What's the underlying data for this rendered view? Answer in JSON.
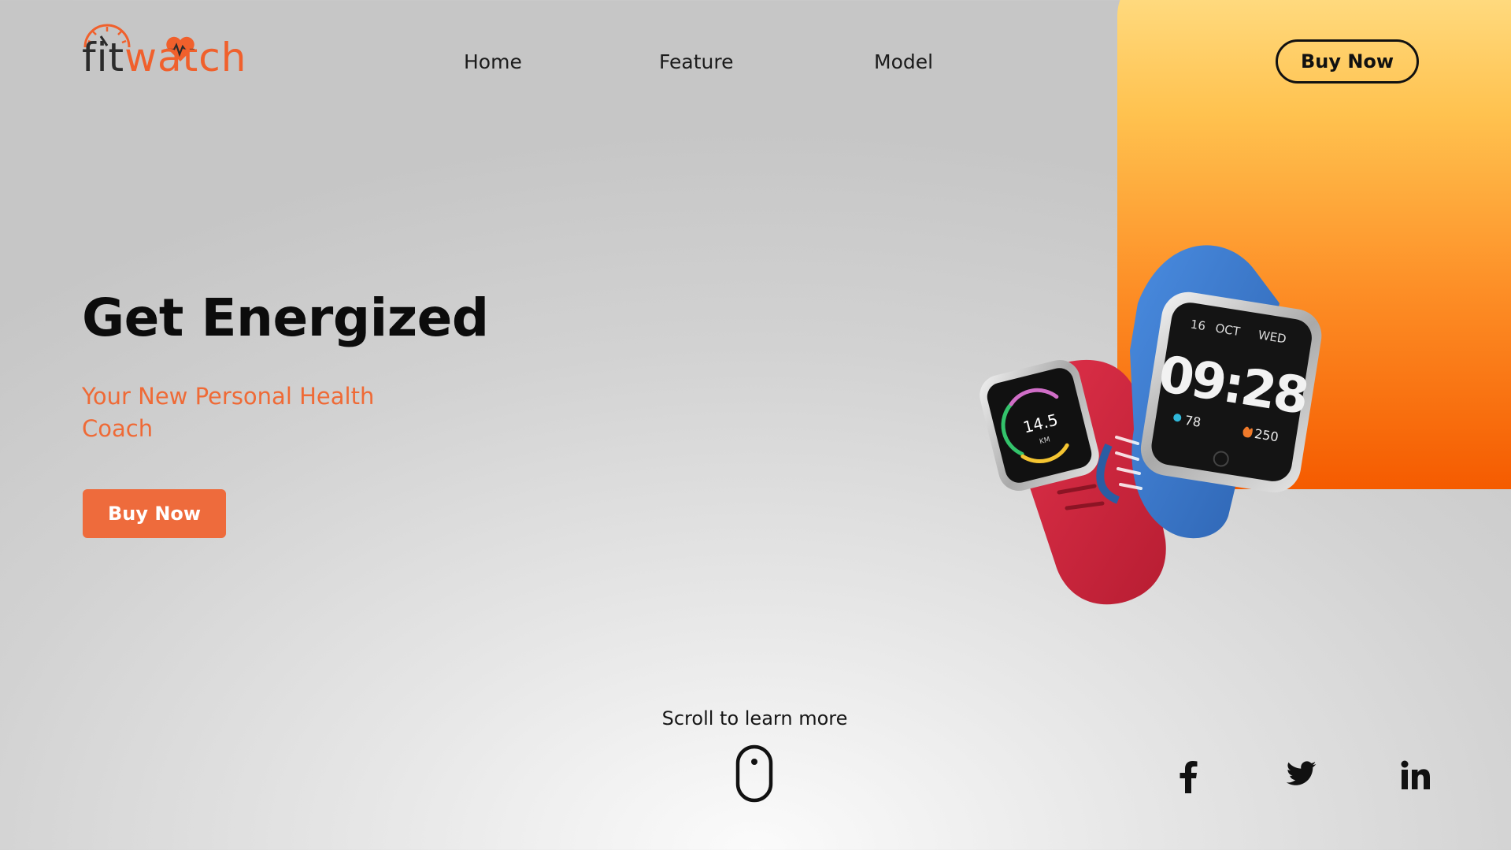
{
  "brand": {
    "logo_part1": "fit",
    "logo_part2": "watch",
    "accent_color": "#f0602c",
    "dark_color": "#2b2b2b"
  },
  "nav": {
    "items": [
      {
        "label": "Home"
      },
      {
        "label": "Feature"
      },
      {
        "label": "Model"
      }
    ],
    "cta_label": "Buy Now"
  },
  "hero": {
    "title": "Get Energized",
    "subtitle": "Your New Personal Health Coach",
    "cta_label": "Buy Now",
    "cta_color": "#ee6b3c"
  },
  "product": {
    "big_watch": {
      "date": "16",
      "month": "OCT",
      "weekday": "WED",
      "time": "09:28",
      "steps": "78",
      "calories": "250",
      "band_color": "#3f7fd0"
    },
    "small_watch": {
      "distance": "14.5",
      "unit": "KM",
      "band_color": "#d9283f"
    }
  },
  "scroll_hint": {
    "text": "Scroll to learn more",
    "icon": "mouse-icon"
  },
  "social": [
    {
      "icon": "facebook-icon"
    },
    {
      "icon": "twitter-icon"
    },
    {
      "icon": "linkedin-icon"
    }
  ]
}
